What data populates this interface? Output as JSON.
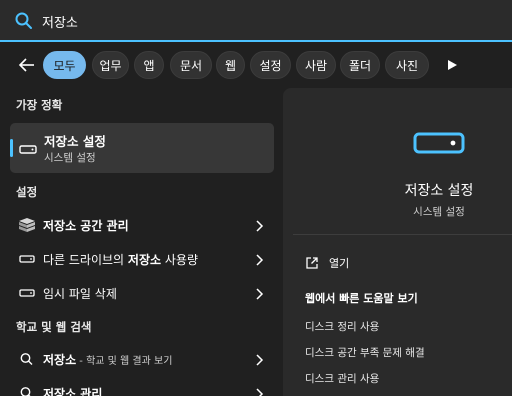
{
  "search": {
    "query": "저장소"
  },
  "filters": {
    "back_icon": "back-arrow-icon",
    "items": [
      "모두",
      "업무",
      "앱",
      "문서",
      "웹",
      "설정",
      "사람",
      "폴더",
      "사진"
    ],
    "active_index": 0,
    "more_icon": "play-icon"
  },
  "best_match": {
    "heading": "가장 정확",
    "title": "저장소 설정",
    "subtitle": "시스템 설정",
    "icon": "storage-drive-icon"
  },
  "settings": {
    "heading": "설정",
    "items": [
      {
        "label": "저장소 공간 관리",
        "icon": "storage-spaces-icon"
      },
      {
        "label_pre": "다른 드라이브의 ",
        "label_bold": "저장소",
        "label_post": " 사용량",
        "icon": "drive-icon"
      },
      {
        "label": "임시 파일 삭제",
        "icon": "drive-icon"
      }
    ]
  },
  "web": {
    "heading": "학교 및 웹 검색",
    "items": [
      {
        "label": "저장소",
        "sub": " - 학교 및 웹 결과 보기",
        "icon": "search-icon"
      },
      {
        "label": "저장소 관리",
        "icon": "search-icon"
      }
    ]
  },
  "detail": {
    "title": "저장소 설정",
    "subtitle": "시스템 설정",
    "open_label": "열기",
    "help_heading": "웹에서 빠른 도움말 보기",
    "help_links": [
      "디스크 정리 사용",
      "디스크 공간 부족 문제 해결",
      "디스크 관리 사용"
    ]
  },
  "colors": {
    "accent": "#4cc2ff",
    "active_chip": "#76b9ed",
    "background": "#202020"
  }
}
